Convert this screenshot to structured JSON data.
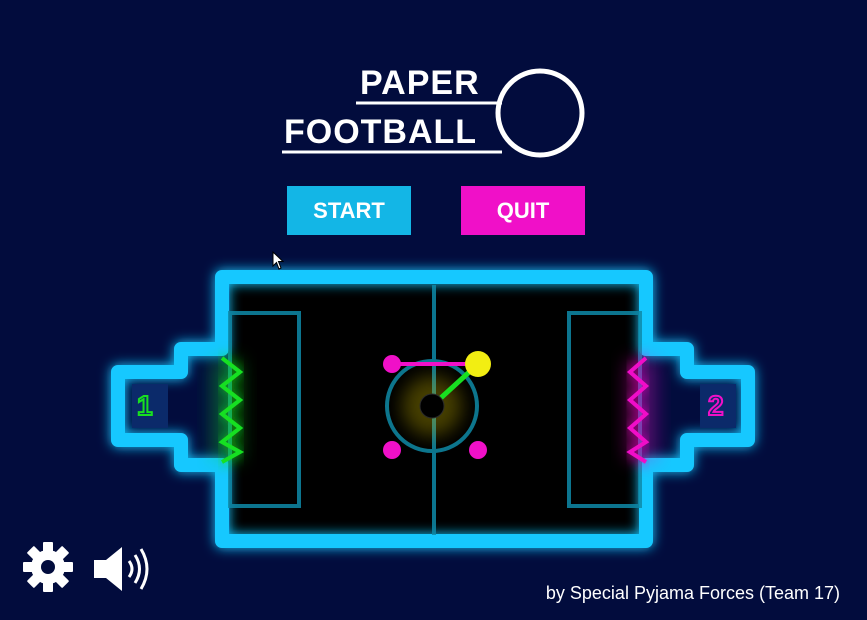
{
  "logo": {
    "line1": "PAPER",
    "line2": "FOOTBALL",
    "ball_icon": "ring-ball-icon"
  },
  "menu": {
    "start_label": "START",
    "quit_label": "QUIT"
  },
  "field": {
    "goal_left_label": "1",
    "goal_right_label": "2",
    "outline_color": "#16c8ff",
    "player1_color": "#18e020",
    "player2_color": "#f010c8",
    "ball_color": "#f2ee12"
  },
  "footer": {
    "settings_icon": "gear-icon",
    "sound_icon": "speaker-icon",
    "credits": "by Special Pyjama Forces (Team 17)"
  },
  "colors": {
    "background": "#020c3d",
    "start_button": "#13b6e6",
    "quit_button": "#f010c8"
  }
}
